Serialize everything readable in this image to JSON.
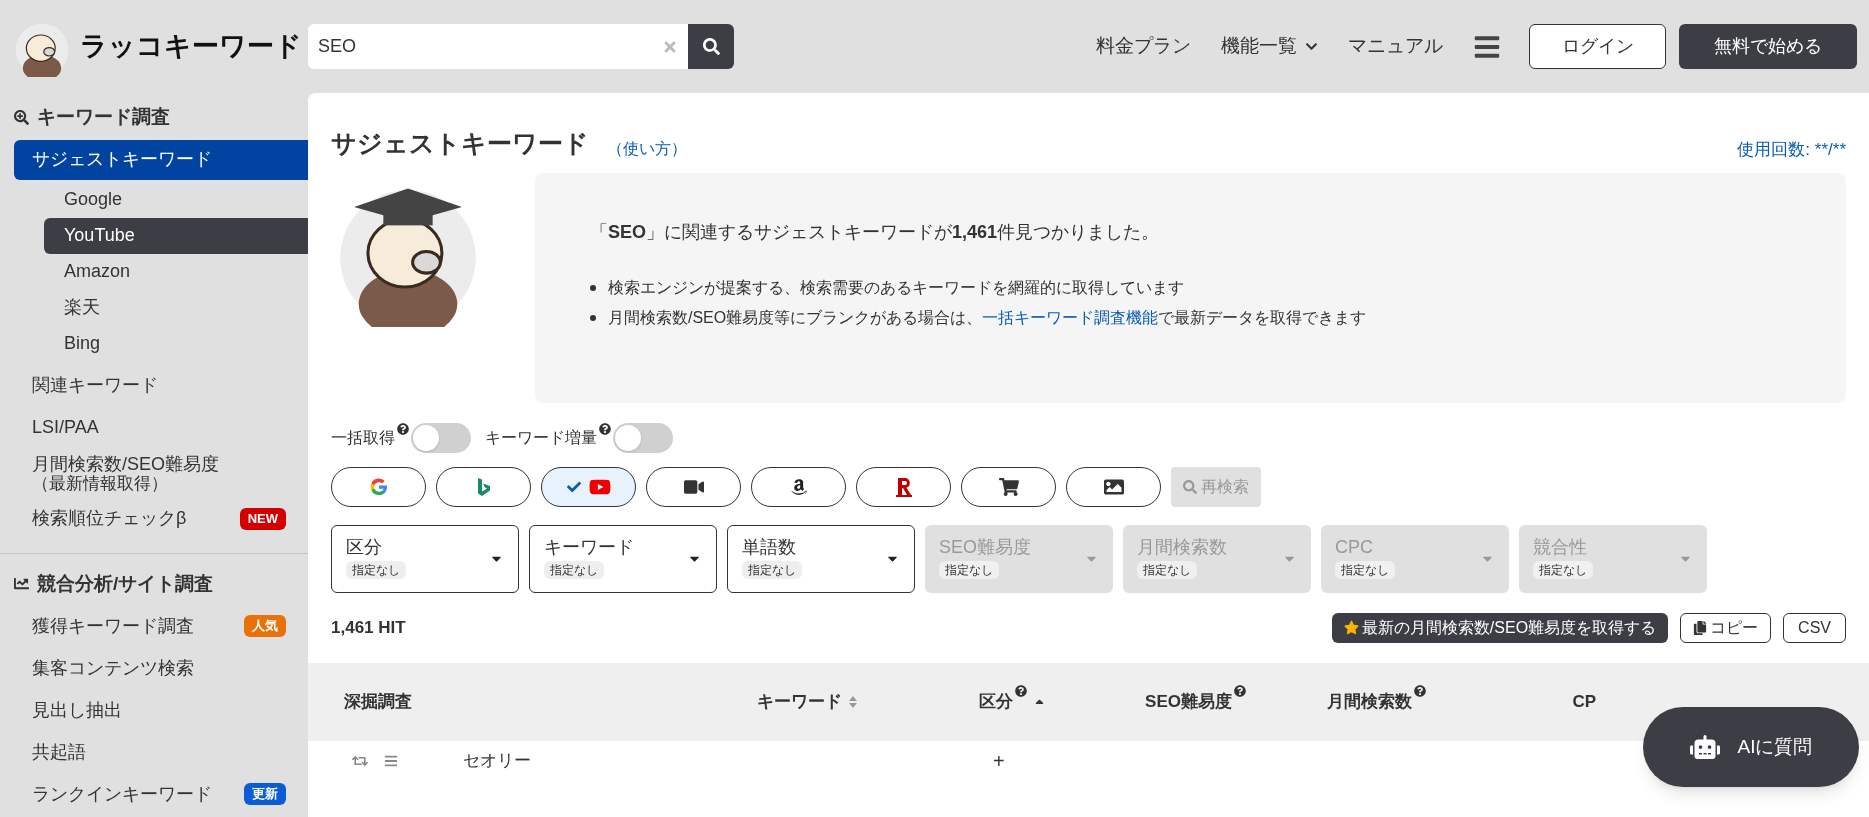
{
  "header": {
    "logo_text": "ラッコキーワード",
    "search": {
      "value": "SEO"
    },
    "nav": [
      {
        "label": "料金プラン",
        "dropdown": false
      },
      {
        "label": "機能一覧",
        "dropdown": true
      },
      {
        "label": "マニュアル",
        "dropdown": false
      }
    ],
    "login": "ログイン",
    "signup": "無料で始める"
  },
  "sidebar": {
    "sections": [
      {
        "title": "キーワード調査",
        "items": [
          {
            "label": "サジェストキーワード",
            "selected": true,
            "children": [
              {
                "label": "Google",
                "selected": false
              },
              {
                "label": "YouTube",
                "selected": true
              },
              {
                "label": "Amazon",
                "selected": false
              },
              {
                "label": "楽天",
                "selected": false
              },
              {
                "label": "Bing",
                "selected": false
              }
            ]
          },
          {
            "label": "関連キーワード",
            "selected": false
          },
          {
            "label": "LSI/PAA",
            "selected": false
          },
          {
            "label": "月間検索数/SEO難易度",
            "note": "（最新情報取得）",
            "selected": false
          },
          {
            "label": "検索順位チェックβ",
            "selected": false,
            "badge": {
              "text": "NEW",
              "color": "#d40000"
            }
          }
        ]
      },
      {
        "title": "競合分析/サイト調査",
        "items": [
          {
            "label": "獲得キーワード調査",
            "selected": false,
            "badge": {
              "text": "人気",
              "color": "#e8710a"
            }
          },
          {
            "label": "集客コンテンツ検索",
            "selected": false
          },
          {
            "label": "見出し抽出",
            "selected": false
          },
          {
            "label": "共起語",
            "selected": false
          },
          {
            "label": "ランクインキーワード",
            "selected": false,
            "badge": {
              "text": "更新",
              "color": "#0b5cd5"
            }
          }
        ]
      }
    ]
  },
  "main": {
    "title": "サジェストキーワード",
    "help_link": "（使い方）",
    "usage": "使用回数: **/**",
    "summary": "「**SEO**」に関連するサジェストキーワードが**1,461**件見つかりました。",
    "bullets": [
      {
        "text": "検索エンジンが提案する、検索需要のあるキーワードを網羅的に取得しています"
      },
      {
        "text": "月間検索数/SEO難易度等にブランクがある場合は、",
        "link": "一括キーワード調査機能",
        "after": "で最新データを取得できます"
      }
    ],
    "toggles": [
      {
        "label": "一括取得",
        "on": false
      },
      {
        "label": "キーワード増量",
        "on": false
      }
    ],
    "sources": [
      {
        "kind": "google",
        "selected": false
      },
      {
        "kind": "bing",
        "selected": false
      },
      {
        "kind": "youtube",
        "selected": true
      },
      {
        "kind": "video",
        "selected": false
      },
      {
        "kind": "amazon",
        "selected": false
      },
      {
        "kind": "rakuten",
        "selected": false
      },
      {
        "kind": "shopping",
        "selected": false
      },
      {
        "kind": "image",
        "selected": false
      }
    ],
    "research_button": "再検索",
    "filters": [
      {
        "label": "区分",
        "value": "指定なし",
        "disabled": false
      },
      {
        "label": "キーワード",
        "value": "指定なし",
        "disabled": false
      },
      {
        "label": "単語数",
        "value": "指定なし",
        "disabled": false
      },
      {
        "label": "SEO難易度",
        "value": "指定なし",
        "disabled": true
      },
      {
        "label": "月間検索数",
        "value": "指定なし",
        "disabled": true
      },
      {
        "label": "CPC",
        "value": "指定なし",
        "disabled": true
      },
      {
        "label": "競合性",
        "value": "指定なし",
        "disabled": true
      }
    ],
    "hit_count": "1,461 HIT",
    "fetch_button": "最新の月間検索数/SEO難易度を取得する",
    "copy_button": "コピー",
    "csv_button": "CSV",
    "table": {
      "columns": [
        {
          "label": "深掘調査",
          "help": false,
          "kind": "plain"
        },
        {
          "label": "キーワード",
          "help": false,
          "kind": "sortable"
        },
        {
          "label": "区分",
          "help": true,
          "kind": "sorted"
        },
        {
          "label": "SEO難易度",
          "help": true,
          "kind": "plain"
        },
        {
          "label": "月間検索数",
          "help": true,
          "kind": "plain"
        },
        {
          "label": "CP",
          "help": false,
          "kind": "plain"
        }
      ],
      "rows": [
        {
          "keyword": "セオリー",
          "category": "+"
        }
      ]
    },
    "ai_button": "AIに質問"
  }
}
